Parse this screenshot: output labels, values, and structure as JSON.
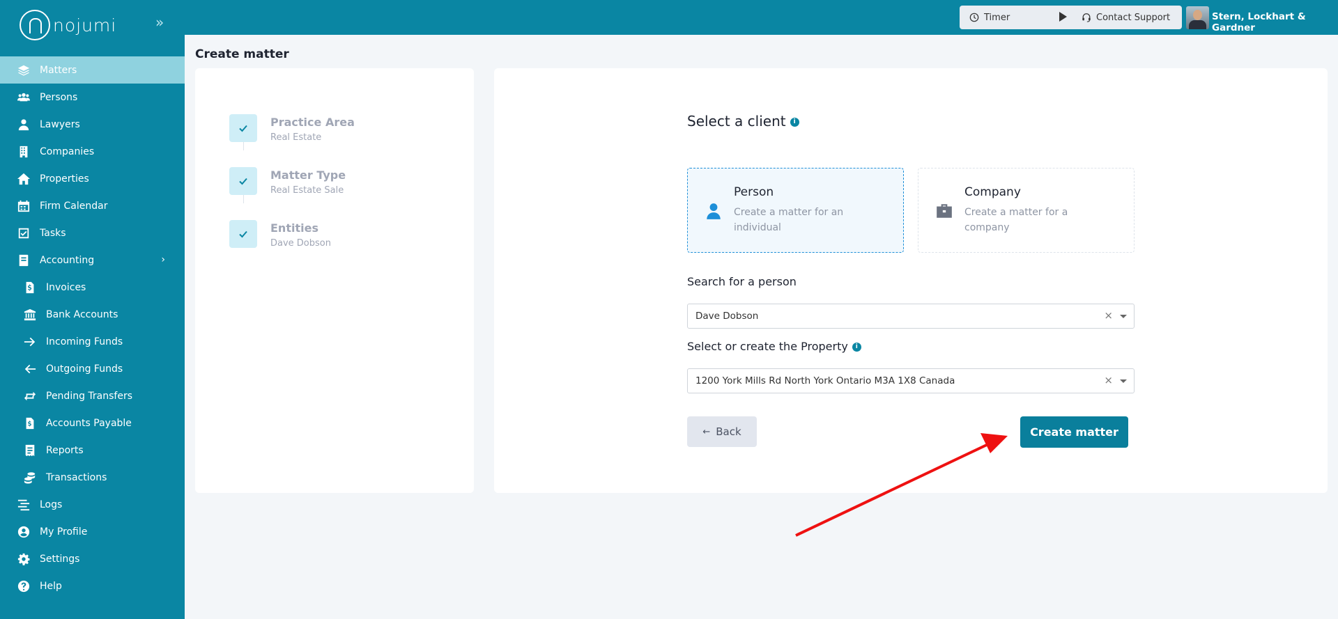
{
  "app": {
    "logo_text": "nojumi"
  },
  "topbar": {
    "timer_label": "Timer",
    "support_label": "Contact Support",
    "firm_name": "Stern, Lockhart & Gardner"
  },
  "sidebar": {
    "items": [
      {
        "label": "Matters"
      },
      {
        "label": "Persons"
      },
      {
        "label": "Lawyers"
      },
      {
        "label": "Companies"
      },
      {
        "label": "Properties"
      },
      {
        "label": "Firm Calendar"
      },
      {
        "label": "Tasks"
      },
      {
        "label": "Accounting"
      },
      {
        "label": "Invoices"
      },
      {
        "label": "Bank Accounts"
      },
      {
        "label": "Incoming Funds"
      },
      {
        "label": "Outgoing Funds"
      },
      {
        "label": "Pending Transfers"
      },
      {
        "label": "Accounts Payable"
      },
      {
        "label": "Reports"
      },
      {
        "label": "Transactions"
      },
      {
        "label": "Logs"
      },
      {
        "label": "My Profile"
      },
      {
        "label": "Settings"
      },
      {
        "label": "Help"
      }
    ]
  },
  "page": {
    "title": "Create matter"
  },
  "steps": [
    {
      "title": "Practice Area",
      "value": "Real Estate"
    },
    {
      "title": "Matter Type",
      "value": "Real Estate Sale"
    },
    {
      "title": "Entities",
      "value": "Dave Dobson"
    }
  ],
  "form": {
    "select_client_title": "Select a client",
    "info_glyph": "i",
    "person_option": {
      "title": "Person",
      "description": "Create a matter for an individual"
    },
    "company_option": {
      "title": "Company",
      "description": "Create a matter for a company"
    },
    "search_person_label": "Search for a person",
    "person_value": "Dave Dobson",
    "property_label": "Select or create the Property",
    "property_value": "1200 York Mills Rd North York Ontario M3A 1X8 Canada",
    "clear_glyph": "×",
    "back_label": "Back",
    "create_label": "Create matter"
  },
  "colors": {
    "brand": "#0a86a3",
    "active_nav": "#8fd2df",
    "annotation_arrow": "#ee1111"
  }
}
